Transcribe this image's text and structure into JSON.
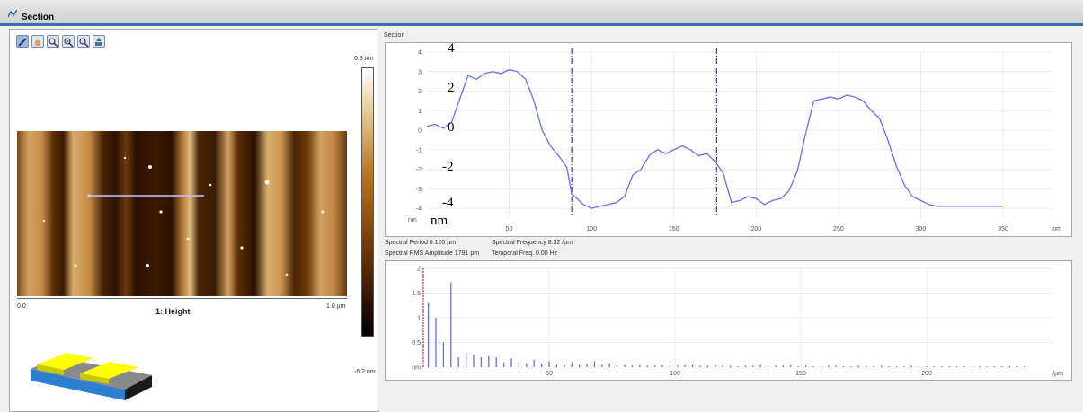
{
  "window": {
    "title": "Section"
  },
  "toolbar": {
    "tools": [
      {
        "icon": "pencil-icon"
      },
      {
        "icon": "hand-icon"
      },
      {
        "icon": "zoom-icon"
      },
      {
        "icon": "zoom-in-icon"
      },
      {
        "icon": "zoom-out-icon"
      },
      {
        "icon": "export-icon"
      }
    ]
  },
  "image": {
    "title": "1: Height",
    "x_start": "0.0",
    "x_end": "1.0 µm",
    "colorbar_max": "6.3 nm",
    "colorbar_min": "-6.2 nm"
  },
  "section": {
    "tab_label": "Section",
    "y_ticks_small": [
      "4",
      "3",
      "2",
      "1",
      "0",
      "-1",
      "-2",
      "-3",
      "-4"
    ],
    "y_unit_small": "nm",
    "x_unit": "nm",
    "x_ticks": [
      "50",
      "100",
      "150",
      "200",
      "250",
      "300",
      "350"
    ],
    "overlay_y_labels": [
      "4",
      "2",
      "0",
      "-2",
      "-4"
    ],
    "overlay_unit": "nm"
  },
  "spectrum_info": {
    "period": "Spectral Period 0.120 µm",
    "frequency": "Spectral Frequency 8.32 /µm",
    "rms": "Spectral RMS Amplitude 1791 pm",
    "temporal": "Temporal Freq. 0.00 Hz"
  },
  "spectrum": {
    "y_ticks": [
      "2",
      "1.5",
      "1",
      "0.5",
      "nm"
    ],
    "x_ticks": [
      "50",
      "100",
      "150",
      "200"
    ],
    "x_unit": "/µm"
  },
  "colors": {
    "trace": "#6b6bf0",
    "cursor": "#4444dd",
    "marker": "#dd2222"
  },
  "chart_data": [
    {
      "type": "line",
      "x": [
        0,
        5,
        10,
        15,
        20,
        25,
        30,
        35,
        40,
        45,
        50,
        55,
        60,
        65,
        70,
        75,
        80,
        85,
        88,
        90,
        95,
        100,
        105,
        110,
        115,
        120,
        125,
        130,
        135,
        140,
        145,
        150,
        155,
        160,
        165,
        170,
        175,
        180,
        185,
        190,
        195,
        200,
        205,
        210,
        215,
        220,
        225,
        230,
        235,
        240,
        245,
        250,
        255,
        260,
        265,
        270,
        275,
        280,
        285,
        290,
        295,
        300,
        305,
        310,
        315,
        320,
        325,
        330,
        335,
        340,
        345,
        350
      ],
      "y": [
        0.2,
        0.3,
        0.1,
        0.4,
        1.6,
        2.8,
        2.6,
        2.9,
        3.0,
        2.9,
        3.1,
        3.0,
        2.6,
        1.5,
        0.0,
        -0.8,
        -1.3,
        -1.9,
        -3.3,
        -3.4,
        -3.8,
        -4.0,
        -3.9,
        -3.8,
        -3.7,
        -3.4,
        -2.3,
        -2.0,
        -1.3,
        -1.0,
        -1.2,
        -1.0,
        -0.8,
        -1.0,
        -1.3,
        -1.2,
        -1.6,
        -2.2,
        -3.7,
        -3.6,
        -3.4,
        -3.5,
        -3.8,
        -3.6,
        -3.5,
        -3.1,
        -2.1,
        -0.2,
        1.5,
        1.6,
        1.7,
        1.6,
        1.8,
        1.7,
        1.5,
        1.0,
        0.6,
        -0.5,
        -1.8,
        -2.8,
        -3.4,
        -3.6,
        -3.8,
        -3.9,
        -3.9,
        -3.9,
        -3.9,
        -3.9,
        -3.9,
        -3.9,
        -3.9,
        -3.9
      ],
      "xlabel": "nm",
      "ylabel": "nm",
      "xlim": [
        0,
        380
      ],
      "ylim": [
        -4.5,
        4
      ],
      "cursors_x": [
        88,
        176
      ]
    },
    {
      "type": "bar",
      "x": [
        2,
        5,
        8,
        11,
        14,
        17,
        20,
        23,
        26,
        29,
        32,
        35,
        38,
        41,
        44,
        47,
        50,
        53,
        56,
        59,
        62,
        65,
        68,
        71,
        74,
        77,
        80,
        83,
        86,
        89,
        92,
        95,
        98,
        101,
        104,
        107,
        110,
        113,
        116,
        119,
        122,
        125,
        128,
        131,
        134,
        137,
        140,
        143,
        146,
        149,
        152,
        155,
        158,
        161,
        164,
        167,
        170,
        173,
        176,
        179,
        182,
        185,
        188,
        191,
        194,
        197,
        200,
        203,
        206,
        209,
        212,
        215,
        218,
        221,
        224,
        227,
        230,
        233,
        236,
        239
      ],
      "values": [
        1.3,
        1.0,
        0.5,
        1.72,
        0.2,
        0.3,
        0.25,
        0.2,
        0.22,
        0.2,
        0.1,
        0.18,
        0.1,
        0.08,
        0.15,
        0.07,
        0.12,
        0.05,
        0.06,
        0.1,
        0.05,
        0.07,
        0.12,
        0.05,
        0.08,
        0.04,
        0.05,
        0.03,
        0.04,
        0.03,
        0.03,
        0.04,
        0.05,
        0.03,
        0.04,
        0.05,
        0.03,
        0.03,
        0.04,
        0.03,
        0.03,
        0.02,
        0.03,
        0.03,
        0.04,
        0.02,
        0.03,
        0.03,
        0.04,
        0.02,
        0.03,
        0.02,
        0.02,
        0.03,
        0.03,
        0.02,
        0.02,
        0.03,
        0.02,
        0.02,
        0.03,
        0.02,
        0.02,
        0.02,
        0.03,
        0.02,
        0.02,
        0.02,
        0.02,
        0.02,
        0.02,
        0.02,
        0.02,
        0.02,
        0.02,
        0.02,
        0.02,
        0.02,
        0.02,
        0.02
      ],
      "xlabel": "/µm",
      "ylabel": "nm",
      "xlim": [
        0,
        250
      ],
      "ylim": [
        0,
        2
      ]
    }
  ]
}
